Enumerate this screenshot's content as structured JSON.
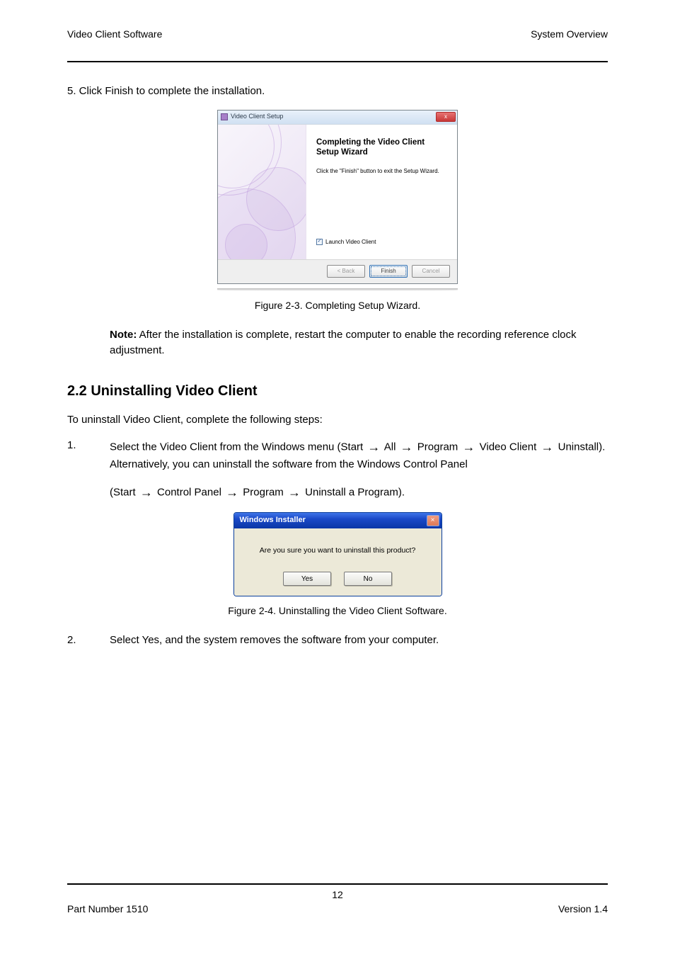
{
  "header": {
    "left": "Video Client Software",
    "right": "System Overview"
  },
  "body": {
    "click_finish": "5.        Click Finish to complete the installation.",
    "fig23": {
      "wizard": {
        "window_title": "Video Client Setup",
        "close_x": "x",
        "heading": "Completing the Video Client Setup Wizard",
        "text": "Click the \"Finish\" button to exit the Setup Wizard.",
        "check_mark": "✓",
        "check_label": "Launch Video Client",
        "btn_back": "< Back",
        "btn_finish": "Finish",
        "btn_cancel": "Cancel"
      },
      "caption": "Figure 2-3. Completing Setup Wizard."
    },
    "note": {
      "label": "Note:",
      "text": "After the installation is complete, restart the computer to enable the recording reference clock adjustment."
    },
    "section_title": "2.2 Uninstalling Video Client",
    "uninstall_intro_1": "To uninstall Video Client, complete the following steps:",
    "step1": {
      "n": "1.",
      "t1": "Select the Video Client from the Windows menu (Start",
      "t2": "All",
      "t3": "Program",
      "t4": "Video Client",
      "t5": "Uninstall)."
    },
    "alt": "Alternatively, you can uninstall the software from the Windows Control Panel",
    "alt_path": {
      "a": "(Start",
      "b": "Control Panel",
      "c": "Program",
      "d": "Uninstall a Program)."
    },
    "fig24": {
      "dialog": {
        "title": "Windows Installer",
        "close_x": "×",
        "message": "Are you sure you want to uninstall this product?",
        "btn_yes": "Yes",
        "btn_no": "No"
      },
      "caption": "Figure 2-4. Uninstalling the Video Client Software."
    },
    "step2": {
      "n": "2.",
      "t": "Select Yes, and the system removes the software from your computer."
    }
  },
  "footer": {
    "page": "12",
    "left": "Part Number 1510",
    "right": "Version 1.4"
  }
}
